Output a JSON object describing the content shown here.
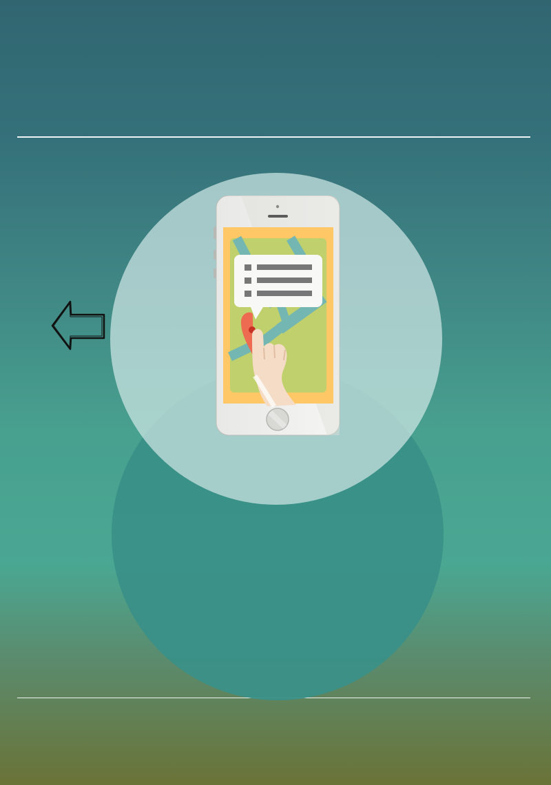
{
  "icons": {
    "back_arrow": "back-arrow-icon",
    "phone_illustration": "phone-map-illustration"
  },
  "colors": {
    "background_top": "#316671",
    "background_mid": "#4aa792",
    "background_bottom": "#6a7337",
    "upper_circle": "#cde6e4",
    "lower_circle": "#3a9088"
  }
}
